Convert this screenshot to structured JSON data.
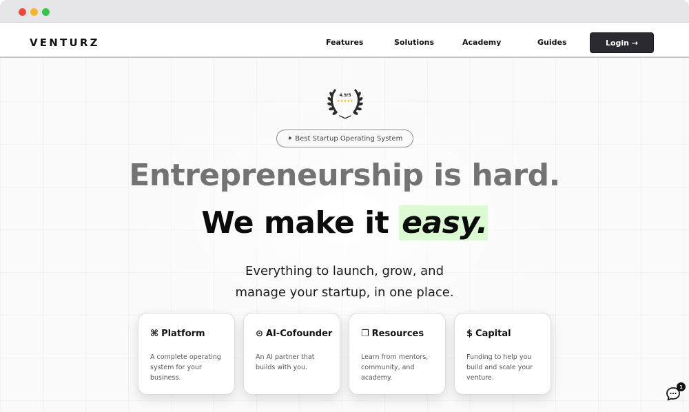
{
  "nav": {
    "logo": "VENTURZ",
    "links": [
      "Features",
      "Solutions",
      "Academy",
      "Guides"
    ],
    "login_label": "Login →"
  },
  "hero": {
    "award_rating": "4.9/5",
    "award_stars": "★★★★★",
    "badge": "✦ Best Startup Operating System",
    "headline_line1": "Entrepreneurship is hard.",
    "headline_line2_prefix": "We make it ",
    "headline_line2_highlight": "easy.",
    "subtext_line1": "Everything to launch, grow, and",
    "subtext_line2": "manage your startup, in one place."
  },
  "cards": [
    {
      "icon": "⌘",
      "icon_name": "command-icon",
      "title": "Platform",
      "description": "A complete operating system for your business."
    },
    {
      "icon": "⊙",
      "icon_name": "target-icon",
      "title": "AI-Cofounder",
      "description": "An AI partner that builds with you."
    },
    {
      "icon": "❐",
      "icon_name": "book-icon",
      "title": "Resources",
      "description": "Learn from mentors, community, and academy."
    },
    {
      "icon": "$",
      "icon_name": "dollar-icon",
      "title": "Capital",
      "description": "Funding to help you build and scale your venture."
    }
  ],
  "chat": {
    "icon_name": "chat-bubble-icon",
    "unread_count": "1"
  },
  "colors": {
    "login_bg": "#2a2a30",
    "highlight": "#dcfbd4",
    "headline_gray": "#737373"
  }
}
